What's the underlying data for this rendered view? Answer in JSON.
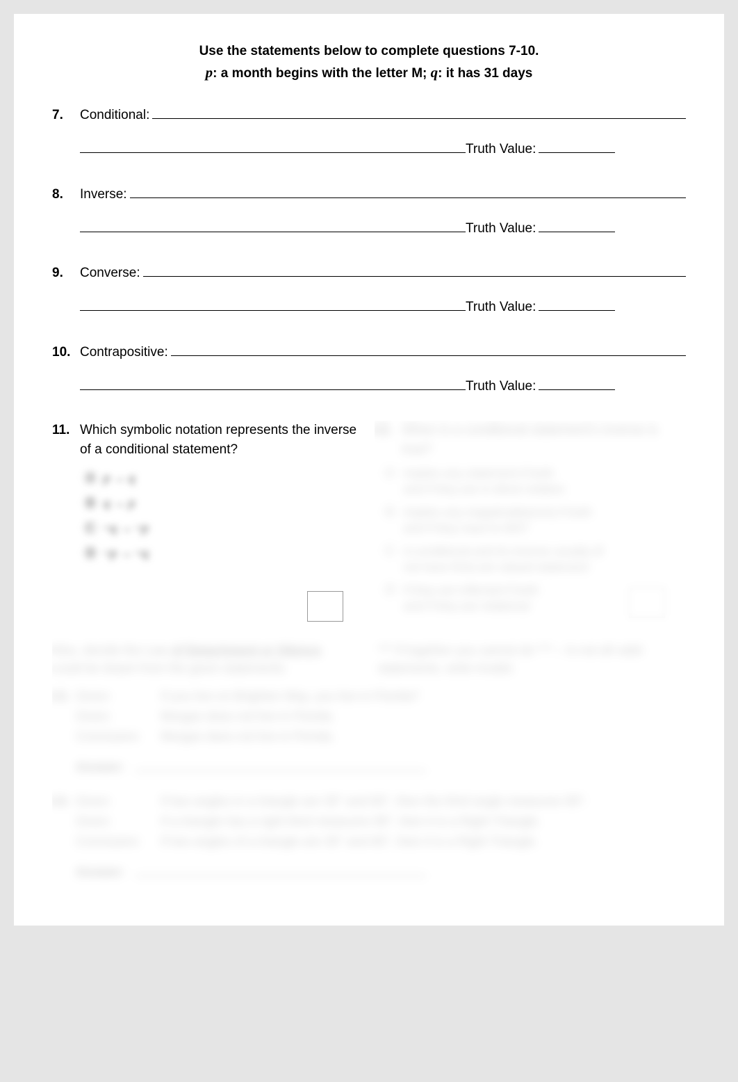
{
  "header": {
    "line1": "Use the statements below to complete questions 7-10.",
    "p_var": "p",
    "p_text": ":  a month begins with the letter M;   ",
    "q_var": "q",
    "q_text": ":  it has 31 days"
  },
  "questions": [
    {
      "num": "7.",
      "label": "Conditional:",
      "truth_label": "Truth Value:"
    },
    {
      "num": "8.",
      "label": "Inverse:",
      "truth_label": "Truth Value:"
    },
    {
      "num": "9.",
      "label": "Converse:",
      "truth_label": "Truth Value:"
    },
    {
      "num": "10.",
      "label": "Contrapositive:",
      "truth_label": "Truth Value:"
    }
  ],
  "q11": {
    "num": "11.",
    "text": "Which symbolic notation represents the inverse of a conditional statement?",
    "choices": [
      {
        "bullet": "Ⓐ",
        "sym": "p → q"
      },
      {
        "bullet": "Ⓑ",
        "sym": "q → p"
      },
      {
        "bullet": "Ⓒ",
        "sym": "~q → ~p"
      },
      {
        "bullet": "Ⓓ",
        "sym": "~p → ~q"
      }
    ]
  },
  "q12": {
    "num": "12.",
    "text": "When is a conditional statement's inverse is true?",
    "choices": [
      {
        "bullet": "Ⓐ",
        "line1": "Implies any statement if both",
        "line2": "and if they are in direct relation"
      },
      {
        "bullet": "Ⓑ",
        "line1": "Implies any inapplicable(one) if both",
        "line2": "and if they react to MST"
      },
      {
        "bullet": "Ⓒ",
        "line1": "A conditional and its inverse usually (if",
        "line2": "not have first) are valued statement"
      },
      {
        "bullet": "Ⓓ",
        "line1": "If they are inflected if both",
        "line2": "and if they are relational"
      }
    ]
  },
  "section": {
    "left_pre": "Also, decide the Law ",
    "left_u": "of Detachment or Silence",
    "left_post": " could be drawn from the given statements.",
    "right_pre": "*** If together you cannot do *** – Is not all valid statements, write invalid."
  },
  "q13": {
    "num": "13.",
    "given": "Given:",
    "given_text": "If you live on Brighten Way, you live in Florida?",
    "given2": "Given:",
    "given2_text": "Morgan does not live in Florida.",
    "conclusion": "Conclusion:",
    "conclusion_text": "Morgan does not live in Florida.",
    "answer": "Answer:"
  },
  "q14": {
    "num": "14.",
    "given": "Given:",
    "given_text": "If two angles in a triangle are 30° and 60°, then the third angle measures 90°.",
    "given2": "Given:",
    "given2_text": "If a triangle has a right third measures 90°, then it is a Right Triangle.",
    "conclusion": "Conclusion:",
    "conclusion_text": "If two angles of a triangle are 30° and 60°, then it is a Right Triangle.",
    "answer": "Answer:"
  }
}
